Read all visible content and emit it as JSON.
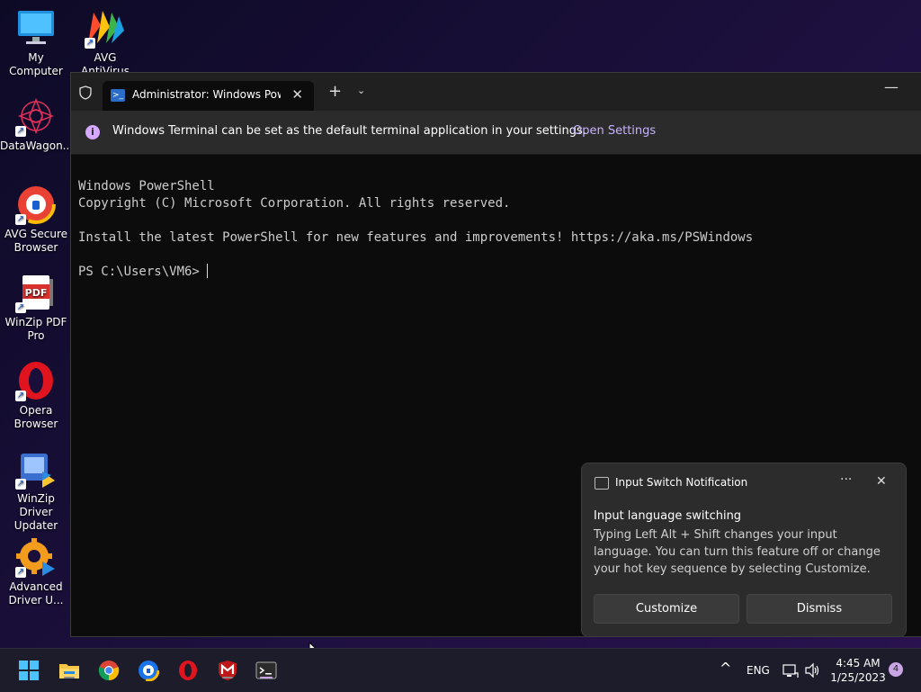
{
  "desktop": {
    "icons": [
      {
        "label": "My Computer"
      },
      {
        "label": "AVG AntiVirus FREE"
      },
      {
        "label": "DataWagon..."
      },
      {
        "label": "AVG Secure Browser"
      },
      {
        "label": "WinZip PDF Pro"
      },
      {
        "label": "Opera Browser"
      },
      {
        "label": "WinZip Driver Updater"
      },
      {
        "label": "Advanced Driver U..."
      }
    ]
  },
  "terminal": {
    "tab_title": "Administrator: Windows PowerShell",
    "tab_close": "✕",
    "new_tab": "+",
    "dropdown": "⌄",
    "minimize": "—",
    "infobar": {
      "message": "Windows Terminal can be set as the default terminal application in your settings.",
      "link": "Open Settings"
    },
    "lines": [
      "Windows PowerShell",
      "Copyright (C) Microsoft Corporation. All rights reserved.",
      "",
      "Install the latest PowerShell for new features and improvements! https://aka.ms/PSWindows",
      ""
    ],
    "prompt": "PS C:\\Users\\VM6> "
  },
  "toast": {
    "app_name": "Input Switch Notification",
    "more": "···",
    "close": "✕",
    "heading": "Input language switching",
    "body": "Typing Left Alt + Shift changes your input language. You can turn this feature off or change your hot key sequence by selecting Customize.",
    "customize_label": "Customize",
    "dismiss_label": "Dismiss"
  },
  "taskbar": {
    "language": "ENG",
    "time": "4:45 AM",
    "date": "1/25/2023",
    "notification_count": "4",
    "overflow_chevron": "^"
  },
  "colors": {
    "accent_link": "#c6b3ff",
    "terminal_bg": "#0c0c0c",
    "titlebar_bg": "#202020"
  }
}
